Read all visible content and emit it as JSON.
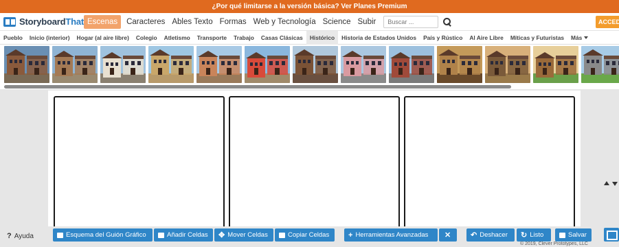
{
  "promo": {
    "text": "¿Por qué limitarse a la versión básica? Ver Planes Premium"
  },
  "header": {
    "logo_main": "Storyboard",
    "logo_accent": "That",
    "nav": [
      {
        "label": "Escenas",
        "active": true
      },
      {
        "label": "Caracteres"
      },
      {
        "label": "Ables Texto"
      },
      {
        "label": "Formas"
      },
      {
        "label": "Web y Tecnología"
      },
      {
        "label": "Science"
      },
      {
        "label": "Subir"
      }
    ],
    "search_placeholder": "Buscar ...",
    "login_label": "ACCEDE"
  },
  "categories": [
    "Pueblo",
    "Inicio (interior)",
    "Hogar (al aire libre)",
    "Colegio",
    "Atletismo",
    "Transporte",
    "Trabajo",
    "Casas Clásicas",
    "Histórico",
    "Historia de Estados Unidos",
    "País y Rústico",
    "Al Aire Libre",
    "Míticas y Futuristas",
    "Más"
  ],
  "active_category": "Histórico",
  "scene_thumbnails": [
    {
      "name": "brick-street",
      "sky": "#6a8fb3",
      "wall": "#8a5a3c",
      "ground": "#7a6a55"
    },
    {
      "name": "stone-row",
      "sky": "#8fb4d4",
      "wall": "#a47a55",
      "ground": "#9a8a70"
    },
    {
      "name": "tudor-house",
      "sky": "#9fc2de",
      "wall": "#e8e0d0",
      "ground": "#8a8070"
    },
    {
      "name": "adobe-town",
      "sky": "#9ec7e3",
      "wall": "#c9a76a",
      "ground": "#b89a6a"
    },
    {
      "name": "market-square",
      "sky": "#a7c9e5",
      "wall": "#c9845a",
      "ground": "#9a7a5a"
    },
    {
      "name": "colorful-row",
      "sky": "#8ab7de",
      "wall": "#d84a3a",
      "ground": "#a08a6a"
    },
    {
      "name": "alley",
      "sky": "#b0c8dc",
      "wall": "#7a5236",
      "ground": "#6a5040"
    },
    {
      "name": "pink-townhouse",
      "sky": "#aac7e0",
      "wall": "#d99aa0",
      "ground": "#8a8a8a"
    },
    {
      "name": "brick-corner",
      "sky": "#9cc0de",
      "wall": "#a04a3a",
      "ground": "#7a7a7a"
    },
    {
      "name": "balcony",
      "sky": "#c49a5a",
      "wall": "#b0824a",
      "ground": "#6a4a2a"
    },
    {
      "name": "castle-interior",
      "sky": "#d8b07a",
      "wall": "#7a5a3a",
      "ground": "#9a7a4a"
    },
    {
      "name": "courtyard",
      "sky": "#e7cf9a",
      "wall": "#9a6a3a",
      "ground": "#6aa04a"
    },
    {
      "name": "castle-green",
      "sky": "#a7cbe6",
      "wall": "#8a8a8a",
      "ground": "#6aa84a"
    },
    {
      "name": "castle-dark",
      "sky": "#4a5a6a",
      "wall": "#7a7060",
      "ground": "#5a5040"
    }
  ],
  "storyboard": {
    "cells": 3
  },
  "toolbar": {
    "help_mark": "?",
    "help_label": "Ayuda",
    "buttons": {
      "layout": "Esquema del Guión Gráfico",
      "add_cells": "Añadir Celdas",
      "move_cells": "Mover Celdas",
      "copy_cells": "Copiar Celdas",
      "advanced": "Herramientas Avanzadas",
      "undo": "Deshacer",
      "done": "Listo",
      "save": "Salvar"
    },
    "copyright": "© 2019, Clever Prototypes, LLC"
  },
  "colors": {
    "brand": "#2a7dc2",
    "promo": "#e06a1f",
    "button": "#2f86c8",
    "accent": "#f39c2c"
  }
}
